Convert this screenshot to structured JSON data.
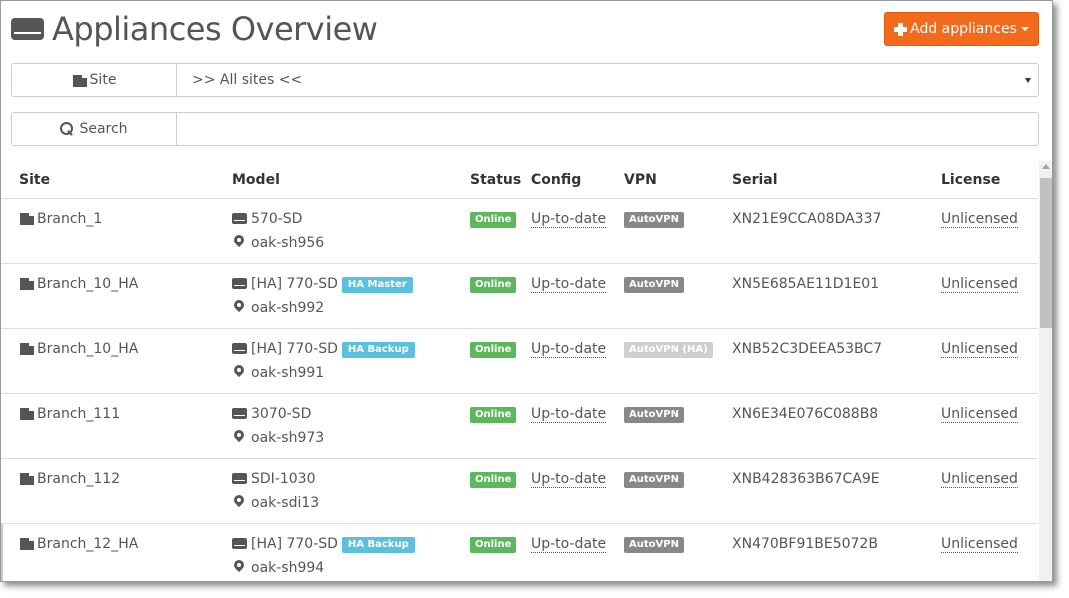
{
  "header": {
    "title": "Appliances Overview",
    "add_button_label": "Add appliances"
  },
  "filters": {
    "site_label": "Site",
    "site_value": ">> All sites <<",
    "search_label": "Search",
    "search_value": ""
  },
  "table": {
    "columns": [
      "Site",
      "Model",
      "Status",
      "Config",
      "VPN",
      "Serial",
      "License"
    ],
    "rows": [
      {
        "site": "Branch_1",
        "model": "570-SD",
        "ha_badge": "",
        "host": "oak-sh956",
        "status": "Online",
        "config": "Up-to-date",
        "vpn": "AutoVPN",
        "serial": "XN21E9CCA08DA337",
        "license": "Unlicensed"
      },
      {
        "site": "Branch_10_HA",
        "model": "[HA] 770-SD",
        "ha_badge": "HA Master",
        "host": "oak-sh992",
        "status": "Online",
        "config": "Up-to-date",
        "vpn": "AutoVPN",
        "serial": "XN5E685AE11D1E01",
        "license": "Unlicensed"
      },
      {
        "site": "Branch_10_HA",
        "model": "[HA] 770-SD",
        "ha_badge": "HA Backup",
        "host": "oak-sh991",
        "status": "Online",
        "config": "Up-to-date",
        "vpn": "AutoVPN (HA)",
        "serial": "XNB52C3DEEA53BC7",
        "license": "Unlicensed"
      },
      {
        "site": "Branch_111",
        "model": "3070-SD",
        "ha_badge": "",
        "host": "oak-sh973",
        "status": "Online",
        "config": "Up-to-date",
        "vpn": "AutoVPN",
        "serial": "XN6E34E076C088B8",
        "license": "Unlicensed"
      },
      {
        "site": "Branch_112",
        "model": "SDI-1030",
        "ha_badge": "",
        "host": "oak-sdi13",
        "status": "Online",
        "config": "Up-to-date",
        "vpn": "AutoVPN",
        "serial": "XNB428363B67CA9E",
        "license": "Unlicensed"
      },
      {
        "site": "Branch_12_HA",
        "model": "[HA] 770-SD",
        "ha_badge": "HA Backup",
        "host": "oak-sh994",
        "status": "Online",
        "config": "Up-to-date",
        "vpn": "AutoVPN",
        "serial": "XN470BF91BE5072B",
        "license": "Unlicensed"
      }
    ]
  },
  "colors": {
    "accent": "#f26a1b",
    "online": "#5cb85c",
    "vpn": "#888888",
    "vpn_dim": "#cfcfcf",
    "ha_badge": "#5bc0de"
  },
  "icons": {
    "title": "appliance-icon",
    "site": "building-icon",
    "search": "search-icon",
    "model": "device-icon",
    "host": "map-marker-icon"
  }
}
